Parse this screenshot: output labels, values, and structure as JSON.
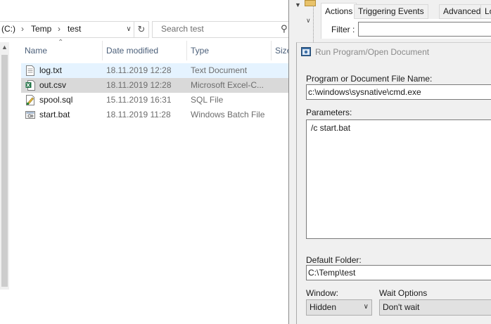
{
  "explorer": {
    "breadcrumb": [
      "(C:)",
      "Temp",
      "test"
    ],
    "search_placeholder": "Search test",
    "columns": [
      "Name",
      "Date modified",
      "Type",
      "Size"
    ],
    "files": [
      {
        "name": "log.txt",
        "date": "18.11.2019 12:28",
        "type": "Text Document",
        "icon": "text-file-icon"
      },
      {
        "name": "out.csv",
        "date": "18.11.2019 12:28",
        "type": "Microsoft Excel-C...",
        "icon": "excel-file-icon"
      },
      {
        "name": "spool.sql",
        "date": "15.11.2019 16:31",
        "type": "SQL File",
        "icon": "sql-file-icon"
      },
      {
        "name": "start.bat",
        "date": "18.11.2019 11:28",
        "type": "Windows Batch File",
        "icon": "batch-file-icon"
      }
    ]
  },
  "scheduler": {
    "tabs": [
      "Actions",
      "Triggering Events",
      "Advanced",
      "Local v"
    ],
    "active_tab": "Actions",
    "filter_label": "Filter :",
    "dialog": {
      "title": "Run Program/Open Document",
      "program_label": "Program or Document File Name:",
      "program_value": "c:\\windows\\sysnative\\cmd.exe",
      "parameters_label": "Parameters:",
      "parameters_value": "/c start.bat",
      "default_folder_label": "Default Folder:",
      "default_folder_value": "C:\\Temp\\test",
      "window_label": "Window:",
      "window_value": "Hidden",
      "wait_label": "Wait Options",
      "wait_value": "Don't wait"
    }
  },
  "colors": {
    "hover_row": "#e5f3ff",
    "selected_row": "#d9d9d9",
    "column_header_text": "#4c607a",
    "dialog_bg": "#f0f0f0"
  }
}
